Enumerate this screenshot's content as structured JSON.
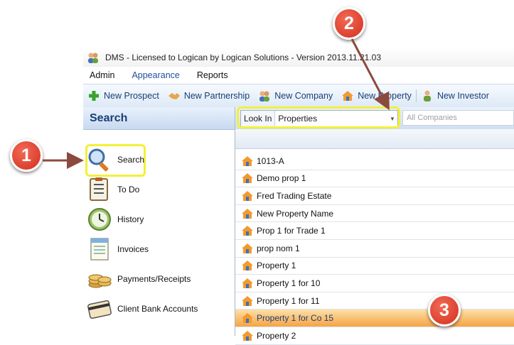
{
  "window": {
    "title": "DMS - Licensed to Logican by Logican Solutions - Version 2013.11.21.03"
  },
  "menu": [
    "Admin",
    "Appearance",
    "Reports"
  ],
  "toolbar": [
    {
      "label": "New Prospect",
      "icon": "plus-icon"
    },
    {
      "label": "New Partnership",
      "icon": "handshake-icon"
    },
    {
      "label": "New Company",
      "icon": "people-icon"
    },
    {
      "label": "New Property",
      "icon": "house-icon"
    },
    {
      "label": "New Investor",
      "icon": "person-icon"
    }
  ],
  "left_pane": {
    "header": "Search",
    "items": [
      {
        "label": "Search",
        "icon": "magnifier-icon"
      },
      {
        "label": "To Do",
        "icon": "checklist-icon"
      },
      {
        "label": "History",
        "icon": "clock-icon"
      },
      {
        "label": "Invoices",
        "icon": "invoice-icon"
      },
      {
        "label": "Payments/Receipts",
        "icon": "coins-icon"
      },
      {
        "label": "Client Bank Accounts",
        "icon": "card-icon"
      }
    ]
  },
  "filters": {
    "look_in_label": "Look In",
    "look_in_value": "Properties",
    "company_placeholder": "All Companies"
  },
  "properties": [
    "1013-A",
    "Demo prop 1",
    "Fred Trading Estate",
    "New Property Name",
    "Prop 1 for Trade 1",
    "prop nom 1",
    "Property 1",
    "Property 1 for 10",
    "Property 1 for 11",
    "Property 1 for Co 15",
    "Property 2"
  ],
  "selected_row": 9,
  "callouts": [
    "1",
    "2",
    "3"
  ],
  "colors": {
    "highlight": "#f3f038",
    "callout": "#d32f1f",
    "selection": "#f6a445",
    "accent": "#1c3e75"
  }
}
